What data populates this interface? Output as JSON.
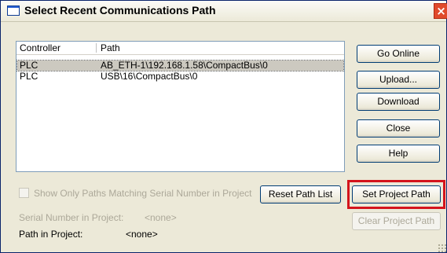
{
  "window": {
    "title": "Select Recent Communications Path",
    "close_glyph": "×"
  },
  "list": {
    "columns": [
      "Controller",
      "Path"
    ],
    "rows": [
      {
        "controller": "PLC",
        "path": "AB_ETH-1\\192.168.1.58\\CompactBus\\0",
        "selected": true
      },
      {
        "controller": "PLC",
        "path": "USB\\16\\CompactBus\\0",
        "selected": false
      }
    ]
  },
  "buttons": {
    "go_online": "Go Online",
    "upload": "Upload...",
    "download": "Download",
    "close": "Close",
    "help": "Help",
    "reset_path_list": "Reset Path List",
    "set_project_path": "Set Project Path",
    "clear_project_path": "Clear Project Path"
  },
  "options": {
    "show_only_matching_label": "Show Only Paths Matching Serial Number in Project",
    "show_only_matching_checked": false
  },
  "info": {
    "serial_label": "Serial Number in Project:",
    "serial_value": "<none>",
    "path_label": "Path in Project:",
    "path_value": "<none>"
  },
  "colors": {
    "highlight": "#d4141c",
    "selection": "#ccc9c0"
  },
  "icons": {
    "title": "window-icon",
    "close": "close-icon",
    "resize": "resize-grip-icon"
  }
}
